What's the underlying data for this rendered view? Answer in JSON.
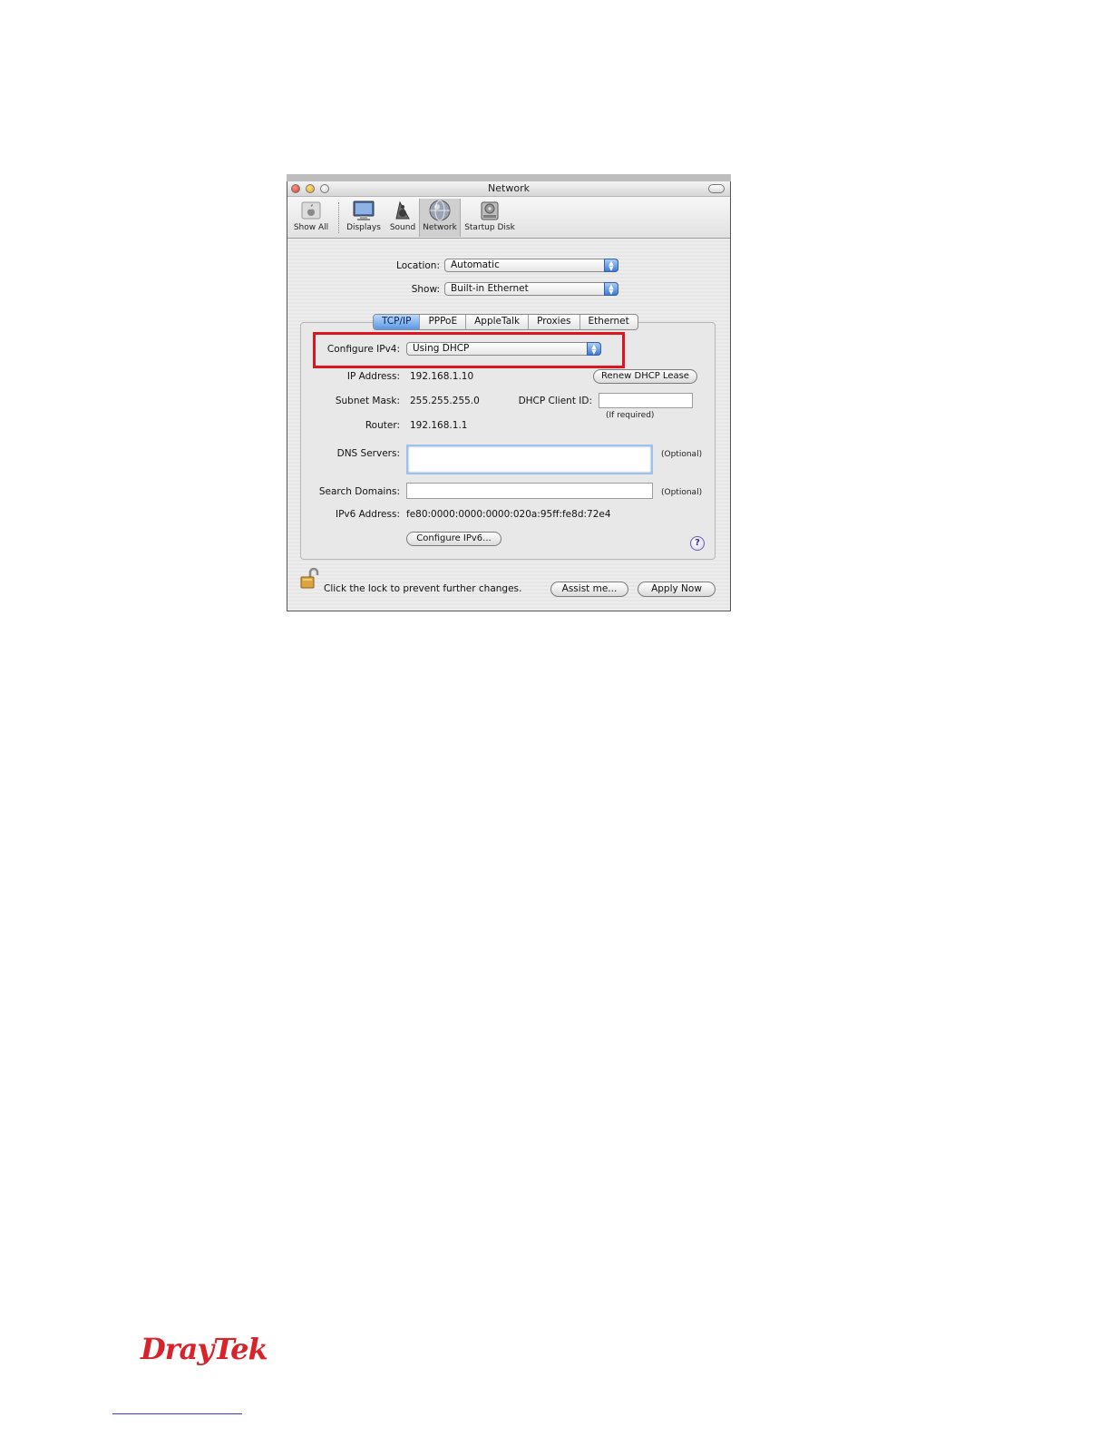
{
  "window": {
    "title": "Network",
    "controls": [
      "close",
      "minimize",
      "zoom"
    ]
  },
  "toolbar": {
    "items": [
      {
        "label": "Show All",
        "icon": "apple-icon"
      },
      {
        "label": "Displays",
        "icon": "display-icon"
      },
      {
        "label": "Sound",
        "icon": "speaker-icon"
      },
      {
        "label": "Network",
        "icon": "network-globe-icon",
        "selected": true
      },
      {
        "label": "Startup Disk",
        "icon": "disk-icon"
      }
    ]
  },
  "location": {
    "label": "Location:",
    "value": "Automatic"
  },
  "show": {
    "label": "Show:",
    "value": "Built-in Ethernet"
  },
  "tabs": [
    {
      "label": "TCP/IP",
      "active": true
    },
    {
      "label": "PPPoE"
    },
    {
      "label": "AppleTalk"
    },
    {
      "label": "Proxies"
    },
    {
      "label": "Ethernet"
    }
  ],
  "tcpip": {
    "configure_label": "Configure IPv4:",
    "configure_value": "Using DHCP",
    "ip_label": "IP Address:",
    "ip_value": "192.168.1.10",
    "renew_button": "Renew DHCP Lease",
    "subnet_label": "Subnet Mask:",
    "subnet_value": "255.255.255.0",
    "client_id_label": "DHCP Client ID:",
    "client_id_value": "",
    "client_id_hint": "(If required)",
    "router_label": "Router:",
    "router_value": "192.168.1.1",
    "dns_label": "DNS Servers:",
    "dns_value": "",
    "dns_hint": "(Optional)",
    "search_label": "Search Domains:",
    "search_value": "",
    "search_hint": "(Optional)",
    "ipv6_label": "IPv6 Address:",
    "ipv6_value": "fe80:0000:0000:0000:020a:95ff:fe8d:72e4",
    "configure_ipv6_button": "Configure IPv6...",
    "help": "?"
  },
  "footer": {
    "lock_message": "Click the lock to prevent further changes.",
    "assist_button": "Assist me...",
    "apply_button": "Apply Now"
  },
  "highlight_color": "#e0141e",
  "brand": {
    "logo_text": "DrayTek",
    "color": "#d8232a"
  }
}
